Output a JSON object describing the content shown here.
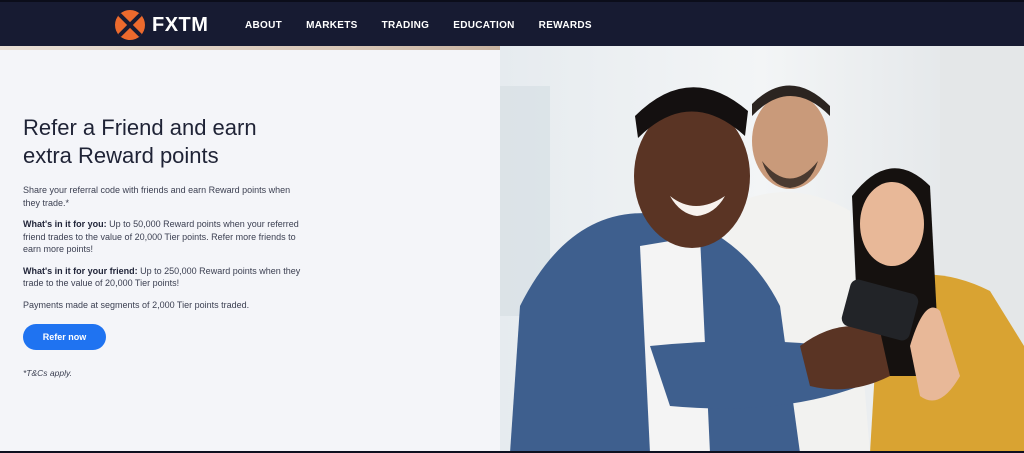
{
  "brand": {
    "name": "FXTM",
    "logo_icon": "fxtm-logo-icon",
    "accent": "#ec6a2d",
    "nav_bg": "#171b32"
  },
  "nav": {
    "items": [
      {
        "label": "ABOUT"
      },
      {
        "label": "MARKETS"
      },
      {
        "label": "TRADING"
      },
      {
        "label": "EDUCATION"
      },
      {
        "label": "REWARDS"
      }
    ]
  },
  "hero": {
    "headline": "Refer a Friend and earn extra Reward points",
    "intro": "Share your referral code with friends and earn Reward points when they trade.*",
    "for_you_label": "What's in it for you:",
    "for_you_text": " Up to 50,000 Reward points when your referred friend trades to the value of 20,000 Tier points. Refer more friends to earn more points!",
    "for_friend_label": "What's in it for your friend:",
    "for_friend_text": " Up to 250,000 Reward points when they trade to the value of 20,000 Tier points!",
    "payments": "Payments made at segments of 2,000 Tier points traded.",
    "cta_label": "Refer now",
    "cta_color": "#1f73f1",
    "tnc": "*T&Cs apply."
  }
}
